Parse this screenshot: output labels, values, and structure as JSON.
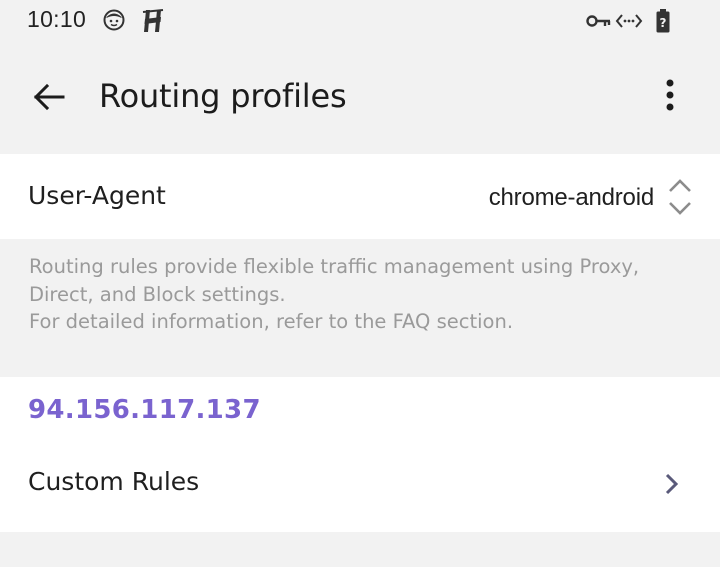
{
  "status_bar": {
    "time": "10:10",
    "icons": [
      "face-icon",
      "h-app-icon",
      "vpn-key-icon",
      "data-transfer-icon",
      "battery-unknown-icon"
    ]
  },
  "app_bar": {
    "title": "Routing profiles",
    "back_icon": "arrow-left-icon",
    "menu_icon": "more-vert-icon"
  },
  "user_agent": {
    "label": "User-Agent",
    "value": "chrome-android"
  },
  "description": {
    "line1": "Routing rules provide flexible traffic management using Proxy,",
    "line2": "Direct, and Block settings.",
    "line3": "For detailed information, refer to the FAQ section."
  },
  "rules": {
    "ip_address": "94.156.117.137",
    "custom_rules_label": "Custom Rules"
  },
  "colors": {
    "accent": "#7a63cf",
    "background": "#f2f2f2",
    "card": "#ffffff",
    "text": "#1f1f1f",
    "muted_text": "#9a9a9a"
  }
}
